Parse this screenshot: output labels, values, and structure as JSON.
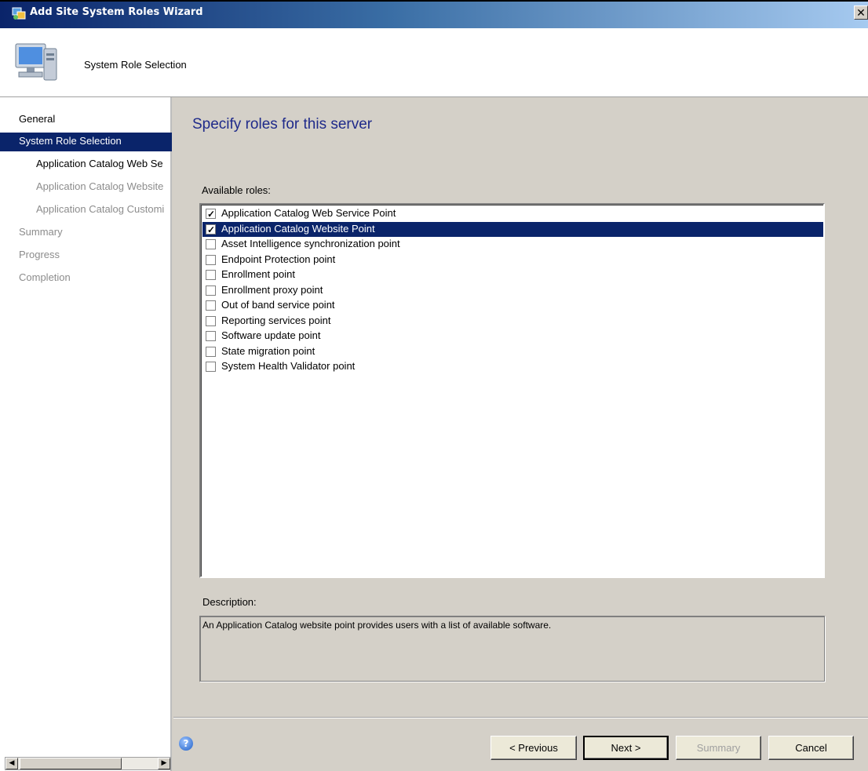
{
  "window": {
    "title": "Add Site System Roles Wizard",
    "close_glyph": "✕",
    "header_title": "System Role Selection"
  },
  "nav": {
    "items": [
      {
        "label": "General",
        "state": "disabled"
      },
      {
        "label": "System Role Selection",
        "state": "selected"
      },
      {
        "label": "Application Catalog Web Se",
        "state": "active-child"
      },
      {
        "label": "Application Catalog Website",
        "state": "disabled"
      },
      {
        "label": "Application Catalog Customi",
        "state": "disabled"
      },
      {
        "label": "Summary",
        "state": "disabled"
      },
      {
        "label": "Progress",
        "state": "disabled"
      },
      {
        "label": "Completion",
        "state": "disabled"
      }
    ]
  },
  "main": {
    "heading": "Specify roles for this server",
    "available_label": "Available roles:",
    "roles": [
      {
        "label": "Application Catalog Web Service Point",
        "checked": true,
        "selected": false
      },
      {
        "label": "Application Catalog Website Point",
        "checked": true,
        "selected": true
      },
      {
        "label": "Asset Intelligence synchronization point",
        "checked": false,
        "selected": false
      },
      {
        "label": "Endpoint Protection point",
        "checked": false,
        "selected": false
      },
      {
        "label": "Enrollment point",
        "checked": false,
        "selected": false
      },
      {
        "label": "Enrollment proxy point",
        "checked": false,
        "selected": false
      },
      {
        "label": "Out of band service point",
        "checked": false,
        "selected": false
      },
      {
        "label": "Reporting services point",
        "checked": false,
        "selected": false
      },
      {
        "label": "Software update point",
        "checked": false,
        "selected": false
      },
      {
        "label": "State migration point",
        "checked": false,
        "selected": false
      },
      {
        "label": "System Health Validator point",
        "checked": false,
        "selected": false
      }
    ],
    "description_label": "Description:",
    "description_text": "An Application Catalog website point provides users with a list of available software."
  },
  "footer": {
    "help_glyph": "?",
    "previous_label": "< Previous",
    "next_label": "Next >",
    "summary_label": "Summary",
    "cancel_label": "Cancel"
  },
  "colors": {
    "selection": "#0a246a",
    "heading": "#1f2a8a"
  }
}
